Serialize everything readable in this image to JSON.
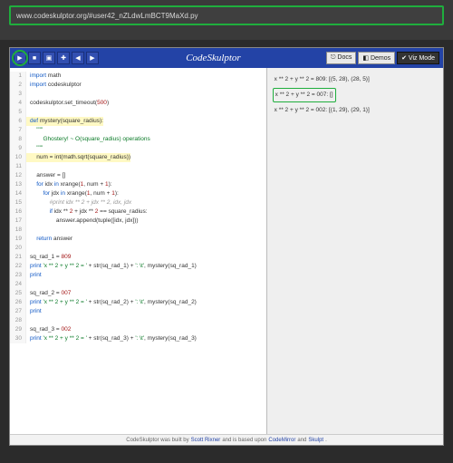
{
  "browser": {
    "url": "www.codeskulptor.org/#user42_nZLdwLmBCT9MaXd.py"
  },
  "toolbar": {
    "title": "CodeSkulptor",
    "play": "▶",
    "left": "◀",
    "right": "▶",
    "save": "■",
    "open": "▣",
    "fresh": "✚",
    "docs": "⎋ Docs",
    "demos": "◧ Demos",
    "viz": "✔ Viz Mode"
  },
  "code": {
    "lines": [
      {
        "n": "1",
        "h": "<span class='kw'>import</span> math"
      },
      {
        "n": "2",
        "h": "<span class='kw'>import</span> codeskulptor"
      },
      {
        "n": "3",
        "h": ""
      },
      {
        "n": "4",
        "h": "codeskulptor.set_timeout(<span class='num'>500</span>)"
      },
      {
        "n": "5",
        "h": ""
      },
      {
        "n": "6",
        "h": "<span class='kw'>def</span> mystery(square_radius):",
        "bg": "hl"
      },
      {
        "n": "7",
        "h": "    <span class='str'>\"\"\"</span>"
      },
      {
        "n": "8",
        "h": "    <span class='str'>    Ghostery! ~ O(square_radius) operations</span>"
      },
      {
        "n": "9",
        "h": "    <span class='str'>\"\"\"</span>"
      },
      {
        "n": "10",
        "h": "    num = int(math.sqrt(square_radius))",
        "bg": "hl"
      },
      {
        "n": "11",
        "h": ""
      },
      {
        "n": "12",
        "h": "    answer = []"
      },
      {
        "n": "13",
        "h": "    <span class='kw'>for</span> idx <span class='kw'>in</span> xrange(<span class='num'>1</span>, num + <span class='num'>1</span>):"
      },
      {
        "n": "14",
        "h": "        <span class='kw'>for</span> jdx <span class='kw'>in</span> xrange(<span class='num'>1</span>, num + <span class='num'>1</span>):"
      },
      {
        "n": "15",
        "h": "            <span class='cm'>#print idx ** 2 + jdx ** 2, idx, jdx</span>"
      },
      {
        "n": "16",
        "h": "            <span class='kw'>if</span> idx ** <span class='num'>2</span> + jdx ** <span class='num'>2</span> == square_radius:"
      },
      {
        "n": "17",
        "h": "                answer.append(tuple([idx, jdx]))"
      },
      {
        "n": "18",
        "h": ""
      },
      {
        "n": "19",
        "h": "    <span class='kw'>return</span> answer"
      },
      {
        "n": "20",
        "h": ""
      },
      {
        "n": "21",
        "h": "sq_rad_1 = <span class='num'>809</span>"
      },
      {
        "n": "22",
        "h": "<span class='kw'>print</span> <span class='str'>'x ** 2 + y ** 2 = '</span> + str(sq_rad_1) + <span class='str'>': \\t'</span>, mystery(sq_rad_1)"
      },
      {
        "n": "23",
        "h": "<span class='kw'>print</span>"
      },
      {
        "n": "24",
        "h": ""
      },
      {
        "n": "25",
        "h": "sq_rad_2 = <span class='num'>007</span>"
      },
      {
        "n": "26",
        "h": "<span class='kw'>print</span> <span class='str'>'x ** 2 + y ** 2 = '</span> + str(sq_rad_2) + <span class='str'>': \\t'</span>, mystery(sq_rad_2)"
      },
      {
        "n": "27",
        "h": "<span class='kw'>print</span>"
      },
      {
        "n": "28",
        "h": ""
      },
      {
        "n": "29",
        "h": "sq_rad_3 = <span class='num'>002</span>"
      },
      {
        "n": "30",
        "h": "<span class='kw'>print</span> <span class='str'>'x ** 2 + y ** 2 = '</span> + str(sq_rad_3) + <span class='str'>': \\t'</span>, mystery(sq_rad_3)"
      }
    ]
  },
  "output": {
    "lines": [
      {
        "t": "x ** 2 + y ** 2 = 809:  [(5, 28), (28, 5)]",
        "sel": false
      },
      {
        "t": "x ** 2 + y ** 2 = 007:  []",
        "sel": true
      },
      {
        "t": "x ** 2 + y ** 2 = 002:  [(1, 29), (29, 1)]",
        "sel": false
      }
    ]
  },
  "footer": {
    "pre": "CodeSkulptor was built by ",
    "a1": "Scott Rixner",
    "mid": " and is based upon ",
    "a2": "CodeMirror",
    "and": " and ",
    "a3": "Skulpt",
    "post": "."
  }
}
